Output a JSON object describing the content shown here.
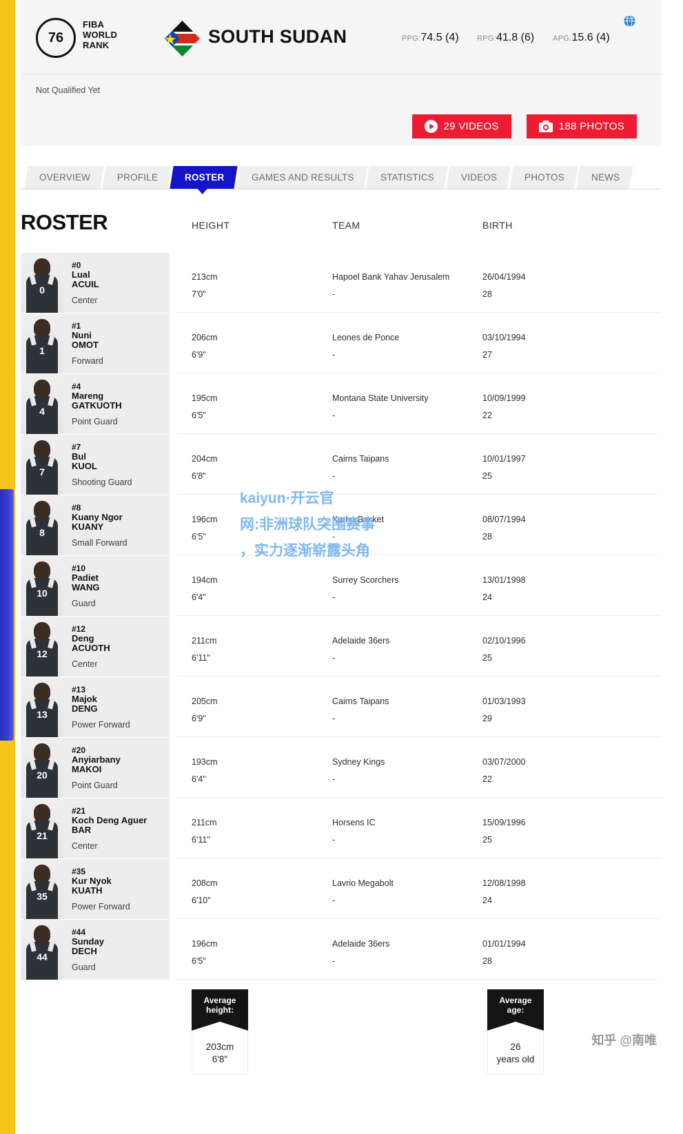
{
  "header": {
    "rank_number": "76",
    "rank_label_line1": "FIBA",
    "rank_label_line2": "WORLD",
    "rank_label_line3": "RANK",
    "country": "SOUTH SUDAN",
    "flag_icon": "south-sudan-flag-icon",
    "globe_icon": "globe-icon",
    "stats": [
      {
        "key": "PPG:",
        "value": "74.5 (4)"
      },
      {
        "key": "RPG:",
        "value": "41.8 (6)"
      },
      {
        "key": "APG:",
        "value": "15.6 (4)"
      }
    ],
    "qualify_status": "Not Qualified Yet",
    "media": {
      "videos_label": "29 VIDEOS",
      "videos_icon": "play-icon",
      "photos_label": "188 PHOTOS",
      "photos_icon": "camera-icon"
    },
    "accent_red": "#ec1d33",
    "accent_blue": "#1414c8"
  },
  "tabs": [
    {
      "label": "OVERVIEW",
      "active": false
    },
    {
      "label": "PROFILE",
      "active": false
    },
    {
      "label": "ROSTER",
      "active": true
    },
    {
      "label": "GAMES AND RESULTS",
      "active": false
    },
    {
      "label": "STATISTICS",
      "active": false
    },
    {
      "label": "VIDEOS",
      "active": false
    },
    {
      "label": "PHOTOS",
      "active": false
    },
    {
      "label": "NEWS",
      "active": false
    }
  ],
  "roster": {
    "title": "ROSTER",
    "columns": {
      "height": "HEIGHT",
      "team": "TEAM",
      "birth": "BIRTH"
    },
    "players": [
      {
        "number": "#0",
        "jersey": "0",
        "first": "Lual",
        "last": "ACUIL",
        "position": "Center",
        "height_cm": "213cm",
        "height_ft": "7'0\"",
        "team": "Hapoel Bank Yahav Jerusalem",
        "team_sub": "-",
        "birth": "26/04/1994",
        "age": "28"
      },
      {
        "number": "#1",
        "jersey": "1",
        "first": "Nuni",
        "last": "OMOT",
        "position": "Forward",
        "height_cm": "206cm",
        "height_ft": "6'9\"",
        "team": "Leones de Ponce",
        "team_sub": "-",
        "birth": "03/10/1994",
        "age": "27"
      },
      {
        "number": "#4",
        "jersey": "4",
        "first": "Mareng",
        "last": "GATKUOTH",
        "position": "Point Guard",
        "height_cm": "195cm",
        "height_ft": "6'5\"",
        "team": "Montana State University",
        "team_sub": "-",
        "birth": "10/09/1999",
        "age": "22"
      },
      {
        "number": "#7",
        "jersey": "7",
        "first": "Bul",
        "last": "KUOL",
        "position": "Shooting Guard",
        "height_cm": "204cm",
        "height_ft": "6'8\"",
        "team": "Cairns Taipans",
        "team_sub": "-",
        "birth": "10/01/1997",
        "age": "25"
      },
      {
        "number": "#8",
        "jersey": "8",
        "first": "Kuany Ngor",
        "last": "KUANY",
        "position": "Small Forward",
        "height_cm": "196cm",
        "height_ft": "6'5\"",
        "team": "Karhu Basket",
        "team_sub": "-",
        "birth": "08/07/1994",
        "age": "28"
      },
      {
        "number": "#10",
        "jersey": "10",
        "first": "Padiet",
        "last": "WANG",
        "position": "Guard",
        "height_cm": "194cm",
        "height_ft": "6'4\"",
        "team": "Surrey Scorchers",
        "team_sub": "-",
        "birth": "13/01/1998",
        "age": "24"
      },
      {
        "number": "#12",
        "jersey": "12",
        "first": "Deng",
        "last": "ACUOTH",
        "position": "Center",
        "height_cm": "211cm",
        "height_ft": "6'11\"",
        "team": "Adelaide 36ers",
        "team_sub": "-",
        "birth": "02/10/1996",
        "age": "25"
      },
      {
        "number": "#13",
        "jersey": "13",
        "first": "Majok",
        "last": "DENG",
        "position": "Power Forward",
        "height_cm": "205cm",
        "height_ft": "6'9\"",
        "team": "Cairns Taipans",
        "team_sub": "-",
        "birth": "01/03/1993",
        "age": "29"
      },
      {
        "number": "#20",
        "jersey": "20",
        "first": "Anyiarbany",
        "last": "MAKOI",
        "position": "Point Guard",
        "height_cm": "193cm",
        "height_ft": "6'4\"",
        "team": "Sydney Kings",
        "team_sub": "-",
        "birth": "03/07/2000",
        "age": "22"
      },
      {
        "number": "#21",
        "jersey": "21",
        "first": "Koch Deng Aguer",
        "last": "BAR",
        "position": "Center",
        "height_cm": "211cm",
        "height_ft": "6'11\"",
        "team": "Horsens IC",
        "team_sub": "-",
        "birth": "15/09/1996",
        "age": "25"
      },
      {
        "number": "#35",
        "jersey": "35",
        "first": "Kur Nyok",
        "last": "KUATH",
        "position": "Power Forward",
        "height_cm": "208cm",
        "height_ft": "6'10\"",
        "team": "Lavrio Megabolt",
        "team_sub": "-",
        "birth": "12/08/1998",
        "age": "24"
      },
      {
        "number": "#44",
        "jersey": "44",
        "first": "Sunday",
        "last": "DECH",
        "position": "Guard",
        "height_cm": "196cm",
        "height_ft": "6'5\"",
        "team": "Adelaide 36ers",
        "team_sub": "-",
        "birth": "01/01/1994",
        "age": "28"
      }
    ]
  },
  "averages": {
    "height": {
      "tag_line1": "Average",
      "tag_line2": "height:",
      "value_line1": "203cm",
      "value_line2": "6'8\""
    },
    "age": {
      "tag_line1": "Average",
      "tag_line2": "age:",
      "value_line1": "26",
      "value_line2": "years old"
    }
  },
  "watermarks": {
    "kaiyun_line1": "kaiyun·开云官",
    "kaiyun_line2": "网:非洲球队突围赛事",
    "kaiyun_line3": "，实力逐渐崭露头角",
    "zhihu": "知乎 @南唯"
  }
}
